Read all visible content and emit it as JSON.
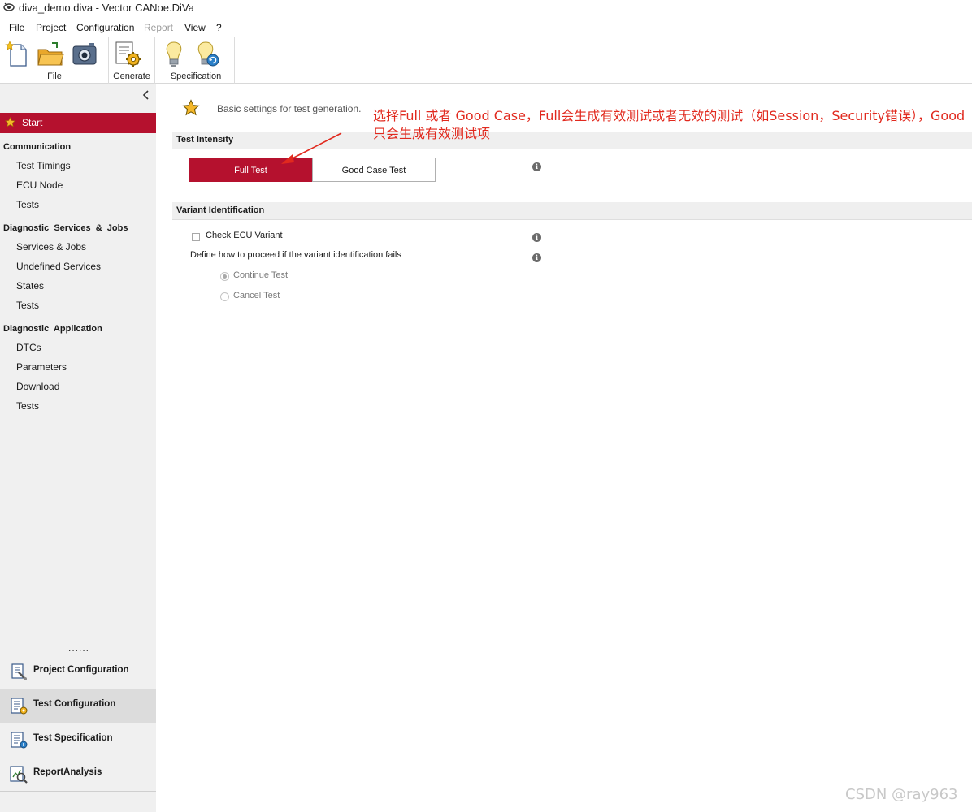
{
  "window": {
    "title": "diva_demo.diva - Vector CANoe.DiVa",
    "app_icon": "eye-app-icon"
  },
  "menu": {
    "items": [
      {
        "label": "File",
        "enabled": true
      },
      {
        "label": "Project",
        "enabled": true
      },
      {
        "label": "Configuration",
        "enabled": true
      },
      {
        "label": "Report",
        "enabled": false
      },
      {
        "label": "View",
        "enabled": true
      },
      {
        "label": "?",
        "enabled": true
      }
    ]
  },
  "ribbon": {
    "groups": [
      {
        "label": "File",
        "buttons": [
          "new-document-icon",
          "open-folder-icon",
          "camera-icon"
        ]
      },
      {
        "label": "Generate",
        "buttons": [
          "generate-gear-icon"
        ]
      },
      {
        "label": "Specification",
        "buttons": [
          "lightbulb-icon",
          "lightbulb-refresh-icon"
        ]
      }
    ]
  },
  "sidebar": {
    "start_label": "Start",
    "sections": [
      {
        "title": "Communication",
        "items": [
          "Test Timings",
          "ECU Node",
          "Tests"
        ]
      },
      {
        "title": "Diagnostic  Services  &  Jobs",
        "items": [
          "Services & Jobs",
          "Undefined Services",
          "States",
          "Tests"
        ]
      },
      {
        "title": "Diagnostic  Application",
        "items": [
          "DTCs",
          "Parameters",
          "Download",
          "Tests"
        ]
      }
    ],
    "more_indicator": "......",
    "bottom_nav": [
      {
        "label": "Project Configuration",
        "icon": "project-configuration-icon",
        "active": false
      },
      {
        "label": "Test Configuration",
        "icon": "test-configuration-icon",
        "active": true
      },
      {
        "label": "Test Specification",
        "icon": "test-specification-icon",
        "active": false
      },
      {
        "label": "ReportAnalysis",
        "icon": "report-analysis-icon",
        "active": false
      }
    ]
  },
  "main": {
    "description": "Basic settings for test generation.",
    "test_intensity": {
      "title": "Test Intensity",
      "options": [
        "Full Test",
        "Good Case Test"
      ],
      "selected": "Full Test"
    },
    "variant_identification": {
      "title": "Variant Identification",
      "check_label": "Check ECU Variant",
      "check_checked": false,
      "define_label": "Define how to proceed if the variant identification fails",
      "radio_options": [
        "Continue Test",
        "Cancel Test"
      ],
      "radio_selected": "Continue Test"
    }
  },
  "annotation": {
    "line1": "选择Full 或者 Good Case，Full会生成有效测试或者无效的测试（如Session，Security错误），Good",
    "line2": "只会生成有效测试项",
    "color": "#e1291e"
  },
  "watermark": "CSDN @ray963",
  "colors": {
    "accent": "#b5112e",
    "sidebar_bg": "#f0f0f0",
    "section_bg": "#efefef"
  }
}
